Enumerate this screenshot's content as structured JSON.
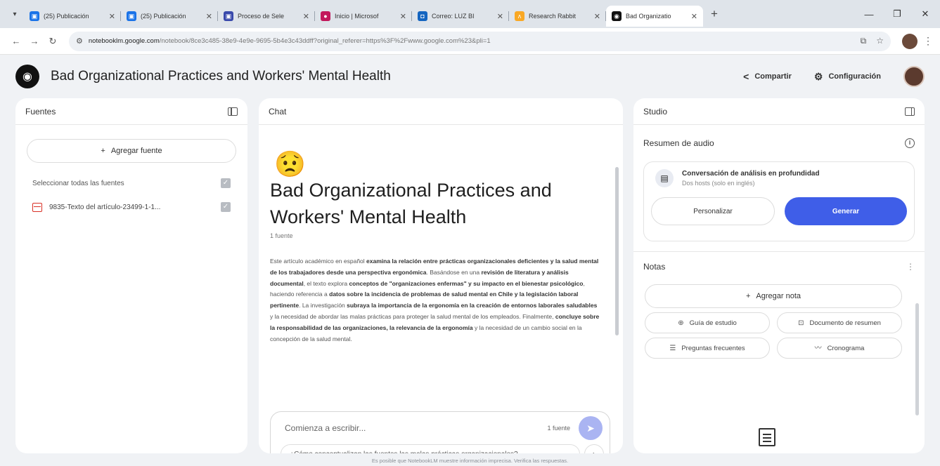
{
  "browser": {
    "tabs": [
      {
        "title": "(25) Publicación",
        "color": "#1a73e8",
        "glyph": "▣",
        "active": false
      },
      {
        "title": "(25) Publicación",
        "color": "#1a73e8",
        "glyph": "▣",
        "active": false
      },
      {
        "title": "Proceso de Sele",
        "color": "#3949ab",
        "glyph": "▣",
        "active": false
      },
      {
        "title": "Inicio | Microsof",
        "color": "#c2185b",
        "glyph": "●",
        "active": false
      },
      {
        "title": "Correo: LUZ BI",
        "color": "#1565c0",
        "glyph": "◘",
        "active": false
      },
      {
        "title": "Research Rabbit",
        "color": "#f9a825",
        "glyph": "ʌ",
        "active": false
      },
      {
        "title": "Bad Organizatio",
        "color": "#111111",
        "glyph": "◉",
        "active": true
      }
    ],
    "url_host": "notebooklm.google.com",
    "url_path": "/notebook/8ce3c485-38e9-4e9e-9695-5b4e3c43ddff?original_referer=https%3F%2Fwww.google.com%23&pli=1"
  },
  "header": {
    "title": "Bad Organizational Practices and Workers' Mental Health",
    "share_label": "Compartir",
    "settings_label": "Configuración"
  },
  "sources": {
    "title": "Fuentes",
    "add_label": "Agregar fuente",
    "select_all_label": "Seleccionar todas las fuentes",
    "items": [
      {
        "name": "9835-Texto del artículo-23499-1-1..."
      }
    ]
  },
  "chat": {
    "title": "Chat",
    "emoji": "😟",
    "notebook_title": "Bad Organizational Practices and Workers' Mental Health",
    "source_count": "1 fuente",
    "summary": [
      {
        "t": "Este artículo académico en español ",
        "b": false
      },
      {
        "t": "examina la relación entre prácticas organizacionales deficientes y la salud mental de los trabajadores desde una perspectiva ergonómica",
        "b": true
      },
      {
        "t": ". Basándose en una ",
        "b": false
      },
      {
        "t": "revisión de literatura y análisis documental",
        "b": true
      },
      {
        "t": ", el texto explora ",
        "b": false
      },
      {
        "t": "conceptos de \"organizaciones enfermas\" y su impacto en el bienestar psicológico",
        "b": true
      },
      {
        "t": ", haciendo referencia a ",
        "b": false
      },
      {
        "t": "datos sobre la incidencia de problemas de salud mental en Chile y la legislación laboral pertinente",
        "b": true
      },
      {
        "t": ". La investigación ",
        "b": false
      },
      {
        "t": "subraya la importancia de la ergonomía en la creación de entornos laborales saludables",
        "b": true
      },
      {
        "t": " y la necesidad de abordar las malas prácticas para proteger la salud mental de los empleados. Finalmente, ",
        "b": false
      },
      {
        "t": "concluye sobre la responsabilidad de las organizaciones, la relevancia de la ergonomía",
        "b": true
      },
      {
        "t": " y la necesidad de un cambio social en la concepción de la salud mental.",
        "b": false
      }
    ],
    "input_placeholder": "Comienza a escribir...",
    "input_source_count": "1 fuente",
    "suggestion": "¿Cómo conceptualizan las fuentes las malas prácticas organizacionales?"
  },
  "studio": {
    "title": "Studio",
    "audio_title": "Resumen de audio",
    "card_title": "Conversación de análisis en profundidad",
    "card_sub": "Dos hosts (solo en inglés)",
    "customize_label": "Personalizar",
    "generate_label": "Generar",
    "generate_color": "#3f5ee8",
    "notes_title": "Notas",
    "add_note_label": "Agregar nota",
    "note_buttons": [
      {
        "icon": "⊕",
        "icon_name": "study-guide-icon",
        "label": "Guía de estudio",
        "name": "study-guide-button"
      },
      {
        "icon": "⊡",
        "icon_name": "briefing-doc-icon",
        "label": "Documento de resumen",
        "name": "briefing-doc-button"
      },
      {
        "icon": "☰",
        "icon_name": "faq-icon",
        "label": "Preguntas frecuentes",
        "name": "faq-button"
      },
      {
        "icon": "〰",
        "icon_name": "timeline-icon",
        "label": "Cronograma",
        "name": "timeline-button"
      }
    ]
  },
  "footer": {
    "disclaimer": "Es posible que NotebookLM muestre información imprecisa. Verifica las respuestas."
  }
}
